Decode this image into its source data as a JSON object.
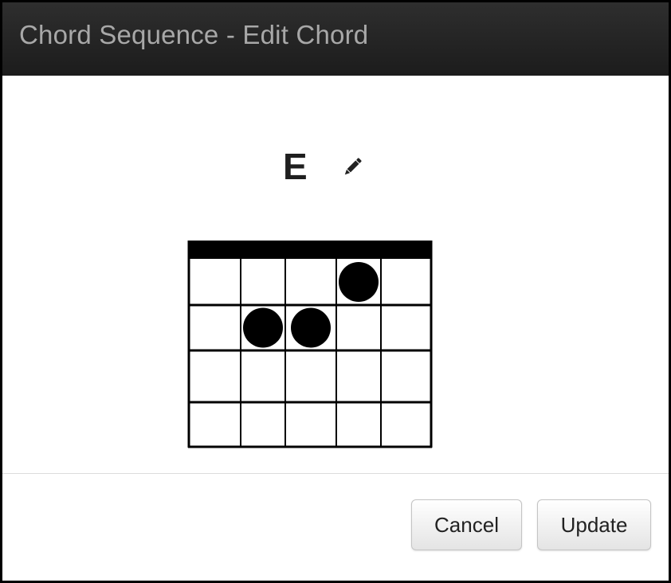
{
  "dialog": {
    "title": "Chord Sequence - Edit Chord"
  },
  "chord": {
    "name": "E",
    "edit_icon": "pencil-icon",
    "strings": 6,
    "frets": 4,
    "fingers": [
      {
        "string": 4,
        "fret": 1
      },
      {
        "string": 2,
        "fret": 2
      },
      {
        "string": 3,
        "fret": 2
      }
    ]
  },
  "buttons": {
    "cancel_label": "Cancel",
    "update_label": "Update"
  },
  "colors": {
    "header_bg": "#232323",
    "title_text": "#a8a8a8",
    "dot": "#000000",
    "grid": "#000000"
  }
}
